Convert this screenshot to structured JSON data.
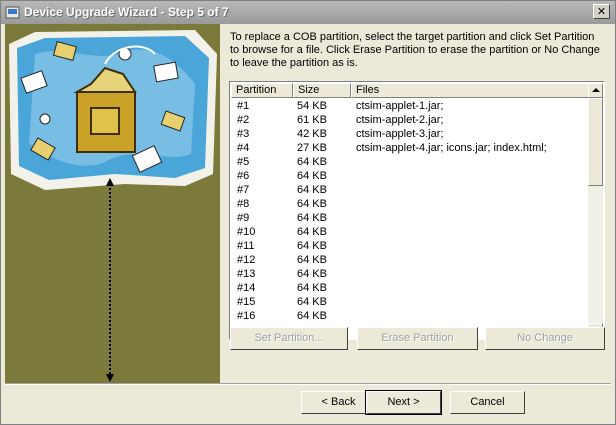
{
  "window": {
    "title": "Device Upgrade Wizard - Step 5 of 7",
    "close_glyph": "✕"
  },
  "instructions": "To replace a COB partition, select the target partition and click Set Partition to browse for a file.  Click Erase Partition to erase the partition or No Change to leave the partition as is.",
  "table": {
    "columns": [
      "Partition",
      "Size",
      "Files"
    ],
    "rows": [
      [
        "#1",
        "54 KB",
        "ctsim-applet-1.jar;"
      ],
      [
        "#2",
        "61 KB",
        "ctsim-applet-2.jar;"
      ],
      [
        "#3",
        "42 KB",
        "ctsim-applet-3.jar;"
      ],
      [
        "#4",
        "27 KB",
        "ctsim-applet-4.jar; icons.jar; index.html;"
      ],
      [
        "#5",
        "64 KB",
        ""
      ],
      [
        "#6",
        "64 KB",
        ""
      ],
      [
        "#7",
        "64 KB",
        ""
      ],
      [
        "#8",
        "64 KB",
        ""
      ],
      [
        "#9",
        "64 KB",
        ""
      ],
      [
        "#10",
        "64 KB",
        ""
      ],
      [
        "#11",
        "64 KB",
        ""
      ],
      [
        "#12",
        "64 KB",
        ""
      ],
      [
        "#13",
        "64 KB",
        ""
      ],
      [
        "#14",
        "64 KB",
        ""
      ],
      [
        "#15",
        "64 KB",
        ""
      ],
      [
        "#16",
        "64 KB",
        ""
      ]
    ]
  },
  "actions": {
    "set_partition": "Set Partition...",
    "erase_partition": "Erase Partition",
    "no_change": "No Change"
  },
  "nav": {
    "back": "< Back",
    "next": "Next >",
    "cancel": "Cancel"
  },
  "colors": {
    "panel_olive": "#7c7a3a",
    "map_blue": "#4aa6d8",
    "package_gold": "#c9a227"
  }
}
